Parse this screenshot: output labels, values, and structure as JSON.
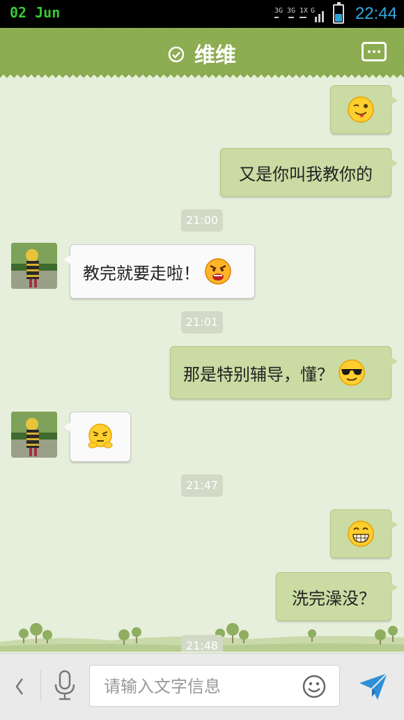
{
  "status_bar": {
    "date": "02 Jun",
    "time": "22:44",
    "network": "3G 3G 1X G"
  },
  "header": {
    "title": "维维",
    "verified_icon": "check-circle-icon",
    "menu_icon": "more-options-icon"
  },
  "messages": [
    {
      "direction": "out",
      "text": "",
      "emoji": "tongue-wink-emoji"
    },
    {
      "direction": "out",
      "text": "又是你叫我教你的",
      "emoji": ""
    },
    {
      "type": "timestamp",
      "text": "21:00"
    },
    {
      "direction": "in",
      "text": "教完就要走啦！",
      "emoji": "angry-emoji"
    },
    {
      "type": "timestamp",
      "text": "21:01"
    },
    {
      "direction": "out",
      "text": "那是特别辅导，懂？",
      "emoji": "sunglasses-emoji"
    },
    {
      "direction": "in",
      "text": "",
      "emoji": "hmph-emoji"
    },
    {
      "type": "timestamp",
      "text": "21:47"
    },
    {
      "direction": "out",
      "text": "",
      "emoji": "grin-emoji"
    },
    {
      "direction": "out",
      "text": "洗完澡没？",
      "emoji": ""
    },
    {
      "type": "timestamp",
      "text": "21:48"
    }
  ],
  "input": {
    "placeholder": "请输入文字信息",
    "value": ""
  },
  "icons": {
    "back": "chevron-left-icon",
    "voice": "microphone-icon",
    "emoji": "smiley-icon",
    "send": "send-icon"
  },
  "colors": {
    "header": "#8aab4e",
    "chat_bg": "#e6efdb",
    "outgoing_bubble": "#cadba3",
    "incoming_bubble": "#fafafa"
  }
}
